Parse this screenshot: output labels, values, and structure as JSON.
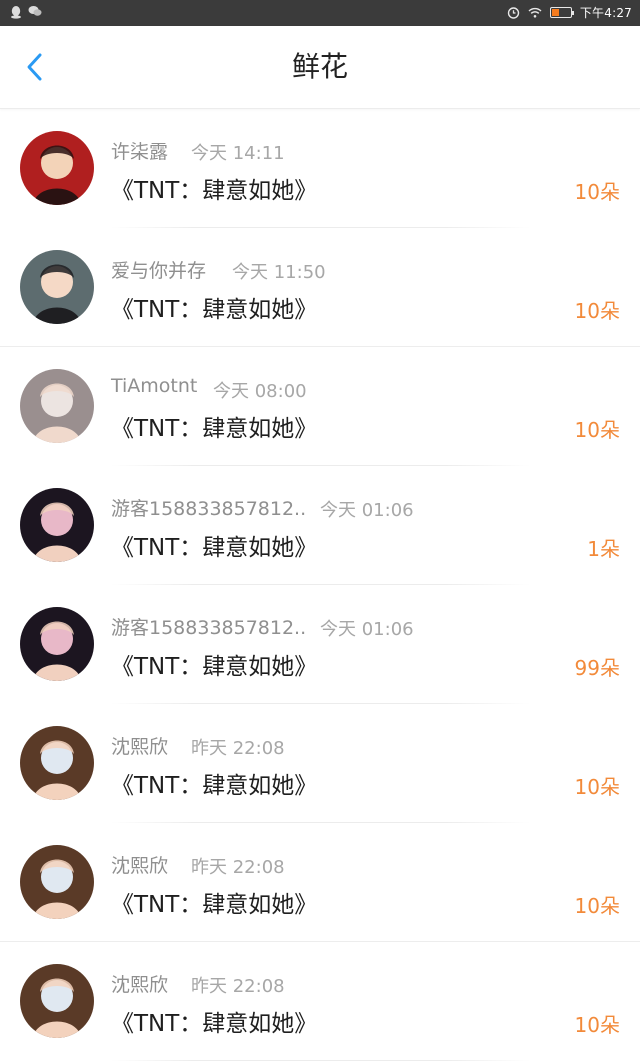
{
  "status_bar": {
    "time": "下午4:27",
    "battery_level": 0.4,
    "colors": {
      "background": "#3b3b3b",
      "battery": "#f57c1f"
    }
  },
  "header": {
    "title": "鲜花",
    "back_icon": "chevron-left-icon",
    "accent": "#2a9af3"
  },
  "items": [
    {
      "name": "许柒露",
      "time": "今天 14:11",
      "book": "《TNT：肆意如她》",
      "count": "10朵",
      "avatar_colors": [
        "#b01f1f",
        "#f3d3b8",
        "#2a1212"
      ]
    },
    {
      "name": "爱与你并存",
      "time": "今天 11:50",
      "book": "《TNT：肆意如她》",
      "count": "10朵",
      "avatar_colors": [
        "#5d6c6f",
        "#f5d9c6",
        "#1f1f22"
      ]
    },
    {
      "name": "TiAmotnt",
      "time": "今天 08:00",
      "book": "《TNT：肆意如她》",
      "count": "10朵",
      "avatar_colors": [
        "#9a8f8f",
        "#ece4e1",
        "#f0d9cc"
      ]
    },
    {
      "name": "游客158833857812..",
      "time": "今天 01:06",
      "book": "《TNT：肆意如她》",
      "count": "1朵",
      "avatar_colors": [
        "#1c1520",
        "#e8b8c8",
        "#f1d0bf"
      ]
    },
    {
      "name": "游客158833857812..",
      "time": "今天 01:06",
      "book": "《TNT：肆意如她》",
      "count": "99朵",
      "avatar_colors": [
        "#1c1520",
        "#e8b8c8",
        "#f1d0bf"
      ]
    },
    {
      "name": "沈熙欣",
      "time": "昨天 22:08",
      "book": "《TNT：肆意如她》",
      "count": "10朵",
      "avatar_colors": [
        "#5a3a27",
        "#e0e8f1",
        "#f3d2bd"
      ]
    },
    {
      "name": "沈熙欣",
      "time": "昨天 22:08",
      "book": "《TNT：肆意如她》",
      "count": "10朵",
      "avatar_colors": [
        "#5a3a27",
        "#e0e8f1",
        "#f3d2bd"
      ]
    },
    {
      "name": "沈熙欣",
      "time": "昨天 22:08",
      "book": "《TNT：肆意如她》",
      "count": "10朵",
      "avatar_colors": [
        "#5a3a27",
        "#e0e8f1",
        "#f3d2bd"
      ]
    }
  ]
}
